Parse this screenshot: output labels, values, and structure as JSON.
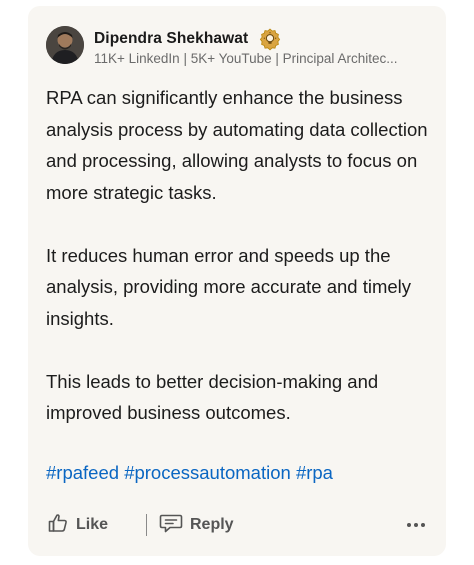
{
  "author": {
    "name": "Dipendra Shekhawat",
    "headline": "11K+ LinkedIn | 5K+ YouTube | Principal Architec..."
  },
  "post": {
    "paragraphs": [
      "RPA can significantly enhance the business analysis process by automating data collection and processing, allowing analysts to focus on more strategic tasks.",
      "It reduces human error and speeds up the analysis, providing more accurate and timely insights.",
      "This leads to better decision-making and improved business outcomes."
    ],
    "hashtags": [
      "#rpafeed",
      "#processautomation",
      "#rpa"
    ]
  },
  "actions": {
    "like_label": "Like",
    "reply_label": "Reply"
  },
  "icons": {
    "badge": "top-voice-badge-icon",
    "like": "thumbs-up-icon",
    "reply": "comment-bubble-icon",
    "more": "more-options-icon"
  },
  "colors": {
    "card_background": "#f8f6f2",
    "hashtag": "#0a66c2",
    "badge": "#b8860b"
  }
}
